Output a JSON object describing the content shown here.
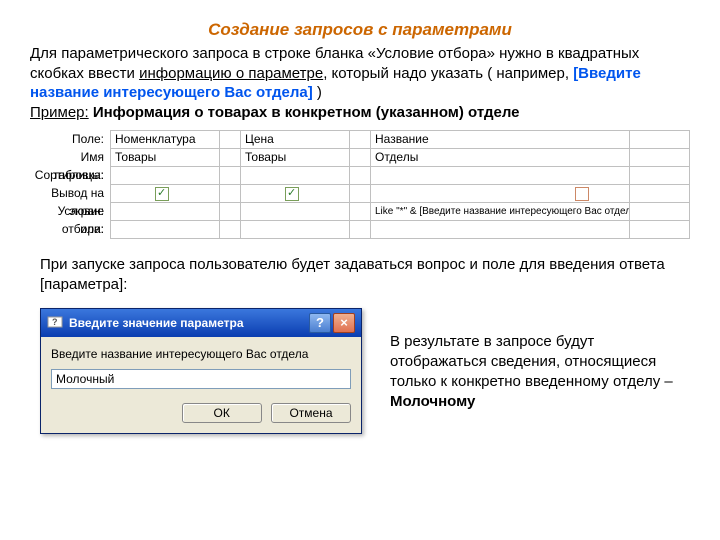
{
  "title": "Создание  запросов  с параметрами",
  "intro": {
    "t1": "Для параметрического запроса в строке бланка «Условие отбора» нужно в квадратных скобках ввести ",
    "t2": "информацию о параметре",
    "t3": ", который надо указать ( например, ",
    "bracket": "[Введите название интересующего Вас отдела]",
    "t4": " )",
    "example_label": "Пример:",
    "example_text": " Информация о товарах в конкретном (указанном) отделе"
  },
  "grid": {
    "labels": {
      "field": "Поле:",
      "table": "Имя таблицы:",
      "sort": "Сортировка:",
      "show": "Вывод на экран:",
      "criteria": "Условие отбора:",
      "or": "или:"
    },
    "cols": {
      "c1_field": "Номенклатура",
      "c1_table": "Товары",
      "c2_field": "Цена",
      "c2_table": "Товары",
      "c3_field": "Название",
      "c3_table": "Отделы",
      "c3_criteria": "Like \"*\" & [Введите название интересующего Вас отдела] & \"*\""
    }
  },
  "mid": {
    "t1": "При запуске запроса пользователю будет задаваться вопрос и поле для введения ответа [параметра]:"
  },
  "dialog": {
    "title": "Введите значение параметра",
    "prompt": "Введите название интересующего Вас отдела",
    "input_value": "Молочный",
    "ok": "ОК",
    "cancel": "Отмена"
  },
  "result": {
    "t1": "В результате в запросе будут отображаться сведения, относящиеся только к конкретно введенному отделу – ",
    "bold": "Молочному"
  }
}
